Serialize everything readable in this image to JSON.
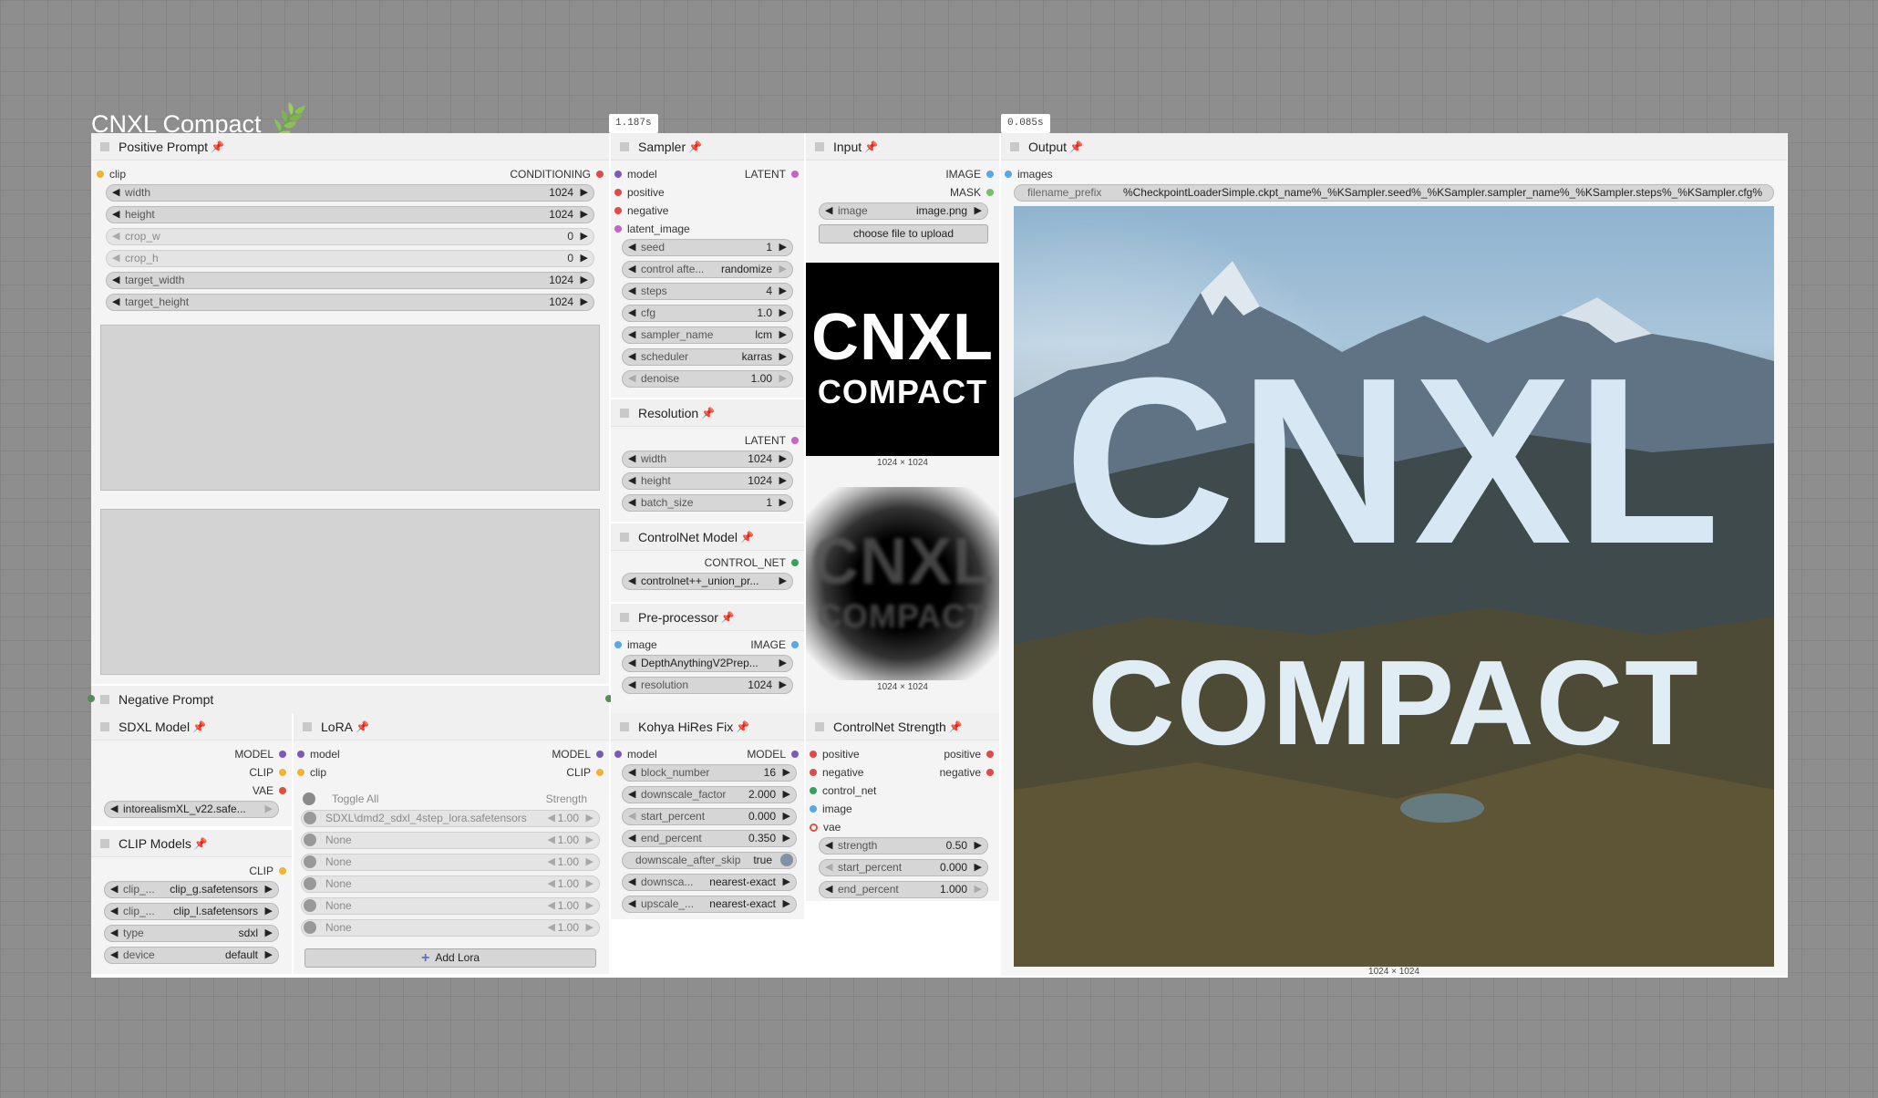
{
  "group": {
    "title": "CNXL Compact"
  },
  "timers": {
    "sampler": "1.187s",
    "output": "0.085s"
  },
  "positive_prompt": {
    "title": "Positive Prompt",
    "input": "clip",
    "output": "CONDITIONING",
    "widgets": [
      {
        "name": "width",
        "value": "1024"
      },
      {
        "name": "height",
        "value": "1024"
      },
      {
        "name": "crop_w",
        "value": "0"
      },
      {
        "name": "crop_h",
        "value": "0"
      },
      {
        "name": "target_width",
        "value": "1024"
      },
      {
        "name": "target_height",
        "value": "1024"
      }
    ]
  },
  "negative_prompt": {
    "title": "Negative Prompt"
  },
  "sampler": {
    "title": "Sampler",
    "inputs": [
      "model",
      "positive",
      "negative",
      "latent_image"
    ],
    "output": "LATENT",
    "widgets": [
      {
        "name": "seed",
        "value": "1"
      },
      {
        "name": "control afte...",
        "value": "randomize"
      },
      {
        "name": "steps",
        "value": "4"
      },
      {
        "name": "cfg",
        "value": "1.0"
      },
      {
        "name": "sampler_name",
        "value": "lcm"
      },
      {
        "name": "scheduler",
        "value": "karras"
      },
      {
        "name": "denoise",
        "value": "1.00"
      }
    ]
  },
  "resolution": {
    "title": "Resolution",
    "output": "LATENT",
    "widgets": [
      {
        "name": "width",
        "value": "1024"
      },
      {
        "name": "height",
        "value": "1024"
      },
      {
        "name": "batch_size",
        "value": "1"
      }
    ]
  },
  "controlnet_model": {
    "title": "ControlNet Model",
    "output": "CONTROL_NET",
    "value": "controlnet++_union_pr..."
  },
  "preprocessor": {
    "title": "Pre-processor",
    "input": "image",
    "output": "IMAGE",
    "widgets": [
      {
        "name": "",
        "value": "DepthAnythingV2Prep..."
      },
      {
        "name": "resolution",
        "value": "1024"
      }
    ]
  },
  "input_node": {
    "title": "Input",
    "outputs": [
      "IMAGE",
      "MASK"
    ],
    "image_widget": {
      "name": "image",
      "value": "image.png"
    },
    "upload_label": "choose file to upload",
    "preview_text": [
      "CNXL",
      "COMPACT"
    ],
    "caption1": "1024 × 1024",
    "caption2": "1024 × 1024"
  },
  "output_node": {
    "title": "Output",
    "input": "images",
    "filename_widget": {
      "name": "filename_prefix",
      "value": "%CheckpointLoaderSimple.ckpt_name%_%KSampler.seed%_%KSampler.sampler_name%_%KSampler.steps%_%KSampler.cfg%"
    },
    "image_text": [
      "CNXL",
      "COMPACT"
    ],
    "caption": "1024 × 1024"
  },
  "sdxl_model": {
    "title": "SDXL Model",
    "outputs": [
      "MODEL",
      "CLIP",
      "VAE"
    ],
    "value": "intorealismXL_v22.safe..."
  },
  "clip_models": {
    "title": "CLIP Models",
    "output": "CLIP",
    "widgets": [
      {
        "name": "clip_...",
        "value": "clip_g.safetensors"
      },
      {
        "name": "clip_...",
        "value": "clip_l.safetensors"
      },
      {
        "name": "type",
        "value": "sdxl"
      },
      {
        "name": "device",
        "value": "default"
      }
    ]
  },
  "lora": {
    "title": "LoRA",
    "inputs": [
      "model",
      "clip"
    ],
    "outputs": [
      "MODEL",
      "CLIP"
    ],
    "toggle_all": "Toggle All",
    "strength_label": "Strength",
    "rows": [
      {
        "name": "SDXL\\dmd2_sdxl_4step_lora.safetensors",
        "strength": "1.00"
      },
      {
        "name": "None",
        "strength": "1.00"
      },
      {
        "name": "None",
        "strength": "1.00"
      },
      {
        "name": "None",
        "strength": "1.00"
      },
      {
        "name": "None",
        "strength": "1.00"
      },
      {
        "name": "None",
        "strength": "1.00"
      }
    ],
    "add_label": "Add Lora"
  },
  "hires_fix": {
    "title": "Kohya HiRes Fix",
    "input": "model",
    "output": "MODEL",
    "widgets": [
      {
        "name": "block_number",
        "value": "16"
      },
      {
        "name": "downscale_factor",
        "value": "2.000"
      },
      {
        "name": "start_percent",
        "value": "0.000"
      },
      {
        "name": "end_percent",
        "value": "0.350"
      },
      {
        "name": "downscale_after_skip",
        "value": "true"
      },
      {
        "name": "downsca...",
        "value": "nearest-exact"
      },
      {
        "name": "upscale_...",
        "value": "nearest-exact"
      }
    ]
  },
  "controlnet_strength": {
    "title": "ControlNet Strength",
    "inputs": [
      "positive",
      "negative",
      "control_net",
      "image",
      "vae"
    ],
    "outputs": [
      "positive",
      "negative"
    ],
    "widgets": [
      {
        "name": "strength",
        "value": "0.50"
      },
      {
        "name": "start_percent",
        "value": "0.000"
      },
      {
        "name": "end_percent",
        "value": "1.000"
      }
    ]
  },
  "colors": {
    "clip": "#f2b233",
    "conditioning": "#e04a4a",
    "model": "#7a5ab6",
    "latent": "#c564c5",
    "image": "#55a9e6",
    "mask": "#74c267",
    "vae": "#e0503c",
    "control_net": "#38a05a"
  }
}
